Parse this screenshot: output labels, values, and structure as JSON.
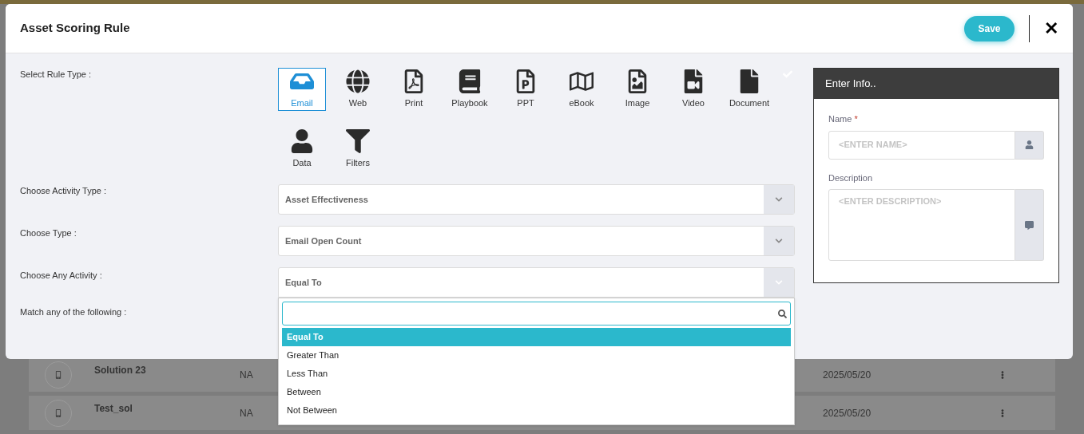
{
  "modal": {
    "title": "Asset Scoring Rule",
    "save_button": "Save",
    "close_button": "✕"
  },
  "rule_type": {
    "label": "Select Rule Type :",
    "options": [
      {
        "kind": "email",
        "label": "Email",
        "selected": true
      },
      {
        "kind": "web",
        "label": "Web",
        "selected": false
      },
      {
        "kind": "print",
        "label": "Print",
        "selected": false
      },
      {
        "kind": "playbook",
        "label": "Playbook",
        "selected": false
      },
      {
        "kind": "ppt",
        "label": "PPT",
        "selected": false
      },
      {
        "kind": "ebook",
        "label": "eBook",
        "selected": false
      },
      {
        "kind": "image",
        "label": "Image",
        "selected": false
      },
      {
        "kind": "video",
        "label": "Video",
        "selected": false
      },
      {
        "kind": "document",
        "label": "Document",
        "selected": false
      },
      {
        "kind": "data",
        "label": "Data",
        "selected": false
      },
      {
        "kind": "filters",
        "label": "Filters",
        "selected": false
      }
    ]
  },
  "fields": [
    {
      "label": "Choose Activity Type :",
      "value": "Asset Effectiveness",
      "expanded": false
    },
    {
      "label": "Choose Type :",
      "value": "Email Open Count",
      "expanded": false
    },
    {
      "label": "Choose Any Activity :",
      "value": "Equal To",
      "expanded": true
    }
  ],
  "match_label": "Match any of the following :",
  "dropdown": {
    "options": [
      {
        "label": "Equal To",
        "selected": true
      },
      {
        "label": "Greater Than",
        "selected": false
      },
      {
        "label": "Less Than",
        "selected": false
      },
      {
        "label": "Between",
        "selected": false
      },
      {
        "label": "Not Between",
        "selected": false
      }
    ]
  },
  "info_panel": {
    "title": "Enter Info..",
    "name_label": "Name",
    "required_mark": "*",
    "name_placeholder": "<ENTER NAME>",
    "description_label": "Description",
    "description_placeholder": "<ENTER DESCRIPTION>"
  },
  "background_rows": [
    {
      "name": "Solution 23",
      "status": "NA",
      "date": "2025/05/20"
    },
    {
      "name": "Test_sol",
      "status": "NA",
      "date": "2025/05/20"
    }
  ]
}
